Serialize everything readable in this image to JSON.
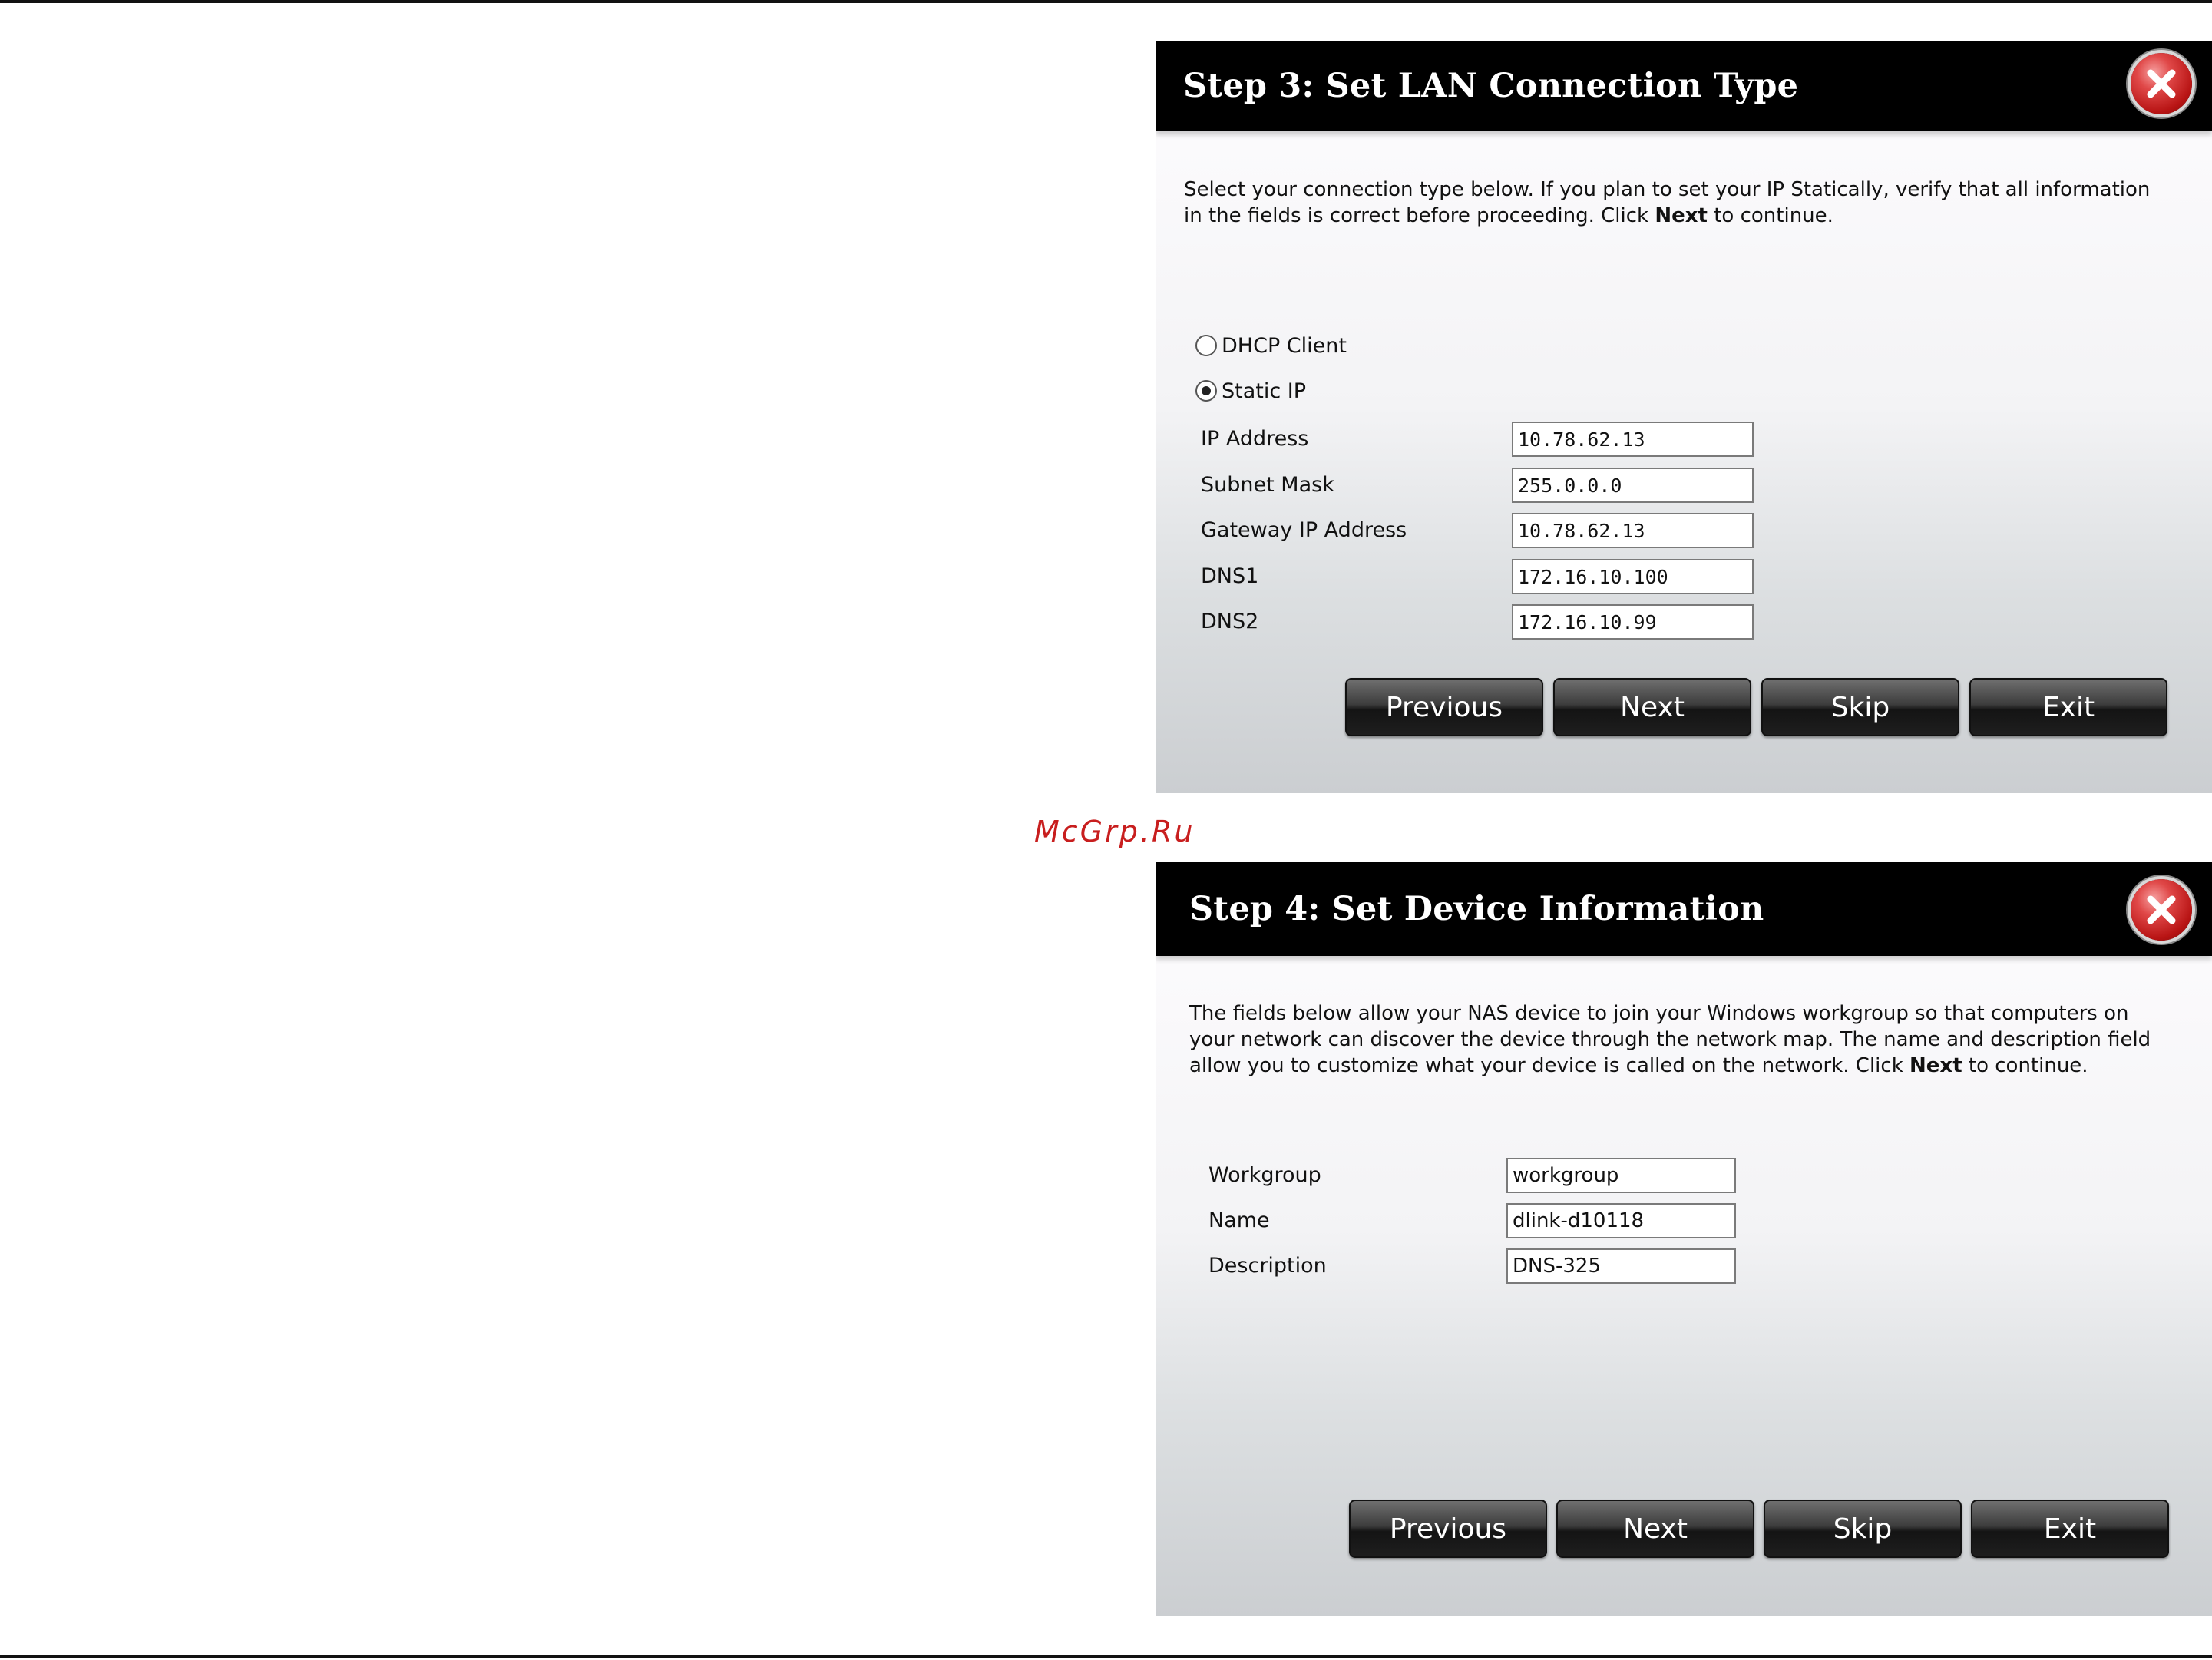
{
  "step3": {
    "title": "Step 3: Set LAN Connection Type",
    "close_icon": "close-icon",
    "description_lead": "Select your connection type below. If you plan to set your IP Statically, verify that all information in the fields is correct before proceeding. Click ",
    "description_bold": "Next",
    "description_tail": " to continue.",
    "radios": [
      {
        "label": "DHCP Client",
        "checked": false
      },
      {
        "label": "Static IP",
        "checked": true
      }
    ],
    "fields": [
      {
        "label": "IP Address",
        "value": "10.78.62.13"
      },
      {
        "label": "Subnet Mask",
        "value": "255.0.0.0"
      },
      {
        "label": "Gateway IP Address",
        "value": "10.78.62.13"
      },
      {
        "label": "DNS1",
        "value": "172.16.10.100"
      },
      {
        "label": "DNS2",
        "value": "172.16.10.99"
      }
    ],
    "buttons": {
      "previous": "Previous",
      "next": "Next",
      "skip": "Skip",
      "exit": "Exit"
    }
  },
  "watermark": "McGrp.Ru",
  "step4": {
    "title": "Step 4: Set Device Information",
    "close_icon": "close-icon",
    "description_lead": "The fields below allow your NAS device to join your Windows workgroup so that computers on your network can discover the device through the network map. The name and description field allow you to customize what your device is called on the network. Click ",
    "description_bold": "Next",
    "description_tail": " to continue.",
    "fields": [
      {
        "label": "Workgroup",
        "value": "workgroup"
      },
      {
        "label": "Name",
        "value": "dlink-d10118"
      },
      {
        "label": "Description",
        "value": "DNS-325"
      }
    ],
    "buttons": {
      "previous": "Previous",
      "next": "Next",
      "skip": "Skip",
      "exit": "Exit"
    }
  }
}
